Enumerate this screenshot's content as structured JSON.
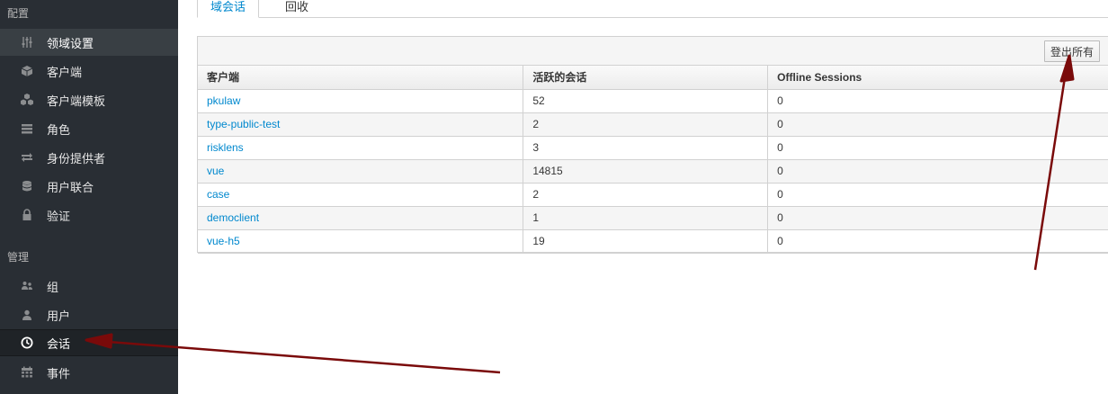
{
  "sidebar": {
    "section_config": "配置",
    "section_manage": "管理",
    "config_items": [
      {
        "label": "领域设置",
        "icon": "sliders-icon"
      },
      {
        "label": "客户端",
        "icon": "cube-icon"
      },
      {
        "label": "客户端模板",
        "icon": "cubes-icon"
      },
      {
        "label": "角色",
        "icon": "list-icon"
      },
      {
        "label": "身份提供者",
        "icon": "exchange-icon"
      },
      {
        "label": "用户联合",
        "icon": "database-icon"
      },
      {
        "label": "验证",
        "icon": "lock-icon"
      }
    ],
    "manage_items": [
      {
        "label": "组",
        "icon": "users-icon"
      },
      {
        "label": "用户",
        "icon": "user-icon"
      },
      {
        "label": "会话",
        "icon": "clock-icon"
      },
      {
        "label": "事件",
        "icon": "calendar-icon"
      }
    ]
  },
  "tabs": [
    "域会话",
    "回收"
  ],
  "toolbar": {
    "logout_all_label": "登出所有"
  },
  "table": {
    "headers": [
      "客户端",
      "活跃的会话",
      "Offline Sessions"
    ],
    "rows": [
      [
        "pkulaw",
        "52",
        "0"
      ],
      [
        "type-public-test",
        "2",
        "0"
      ],
      [
        "risklens",
        "3",
        "0"
      ],
      [
        "vue",
        "14815",
        "0"
      ],
      [
        "case",
        "2",
        "0"
      ],
      [
        "democlient",
        "1",
        "0"
      ],
      [
        "vue-h5",
        "19",
        "0"
      ]
    ]
  },
  "colors": {
    "sidebar_bg": "#292e34",
    "link": "#0088ce",
    "arrow": "#7a0a0a"
  }
}
